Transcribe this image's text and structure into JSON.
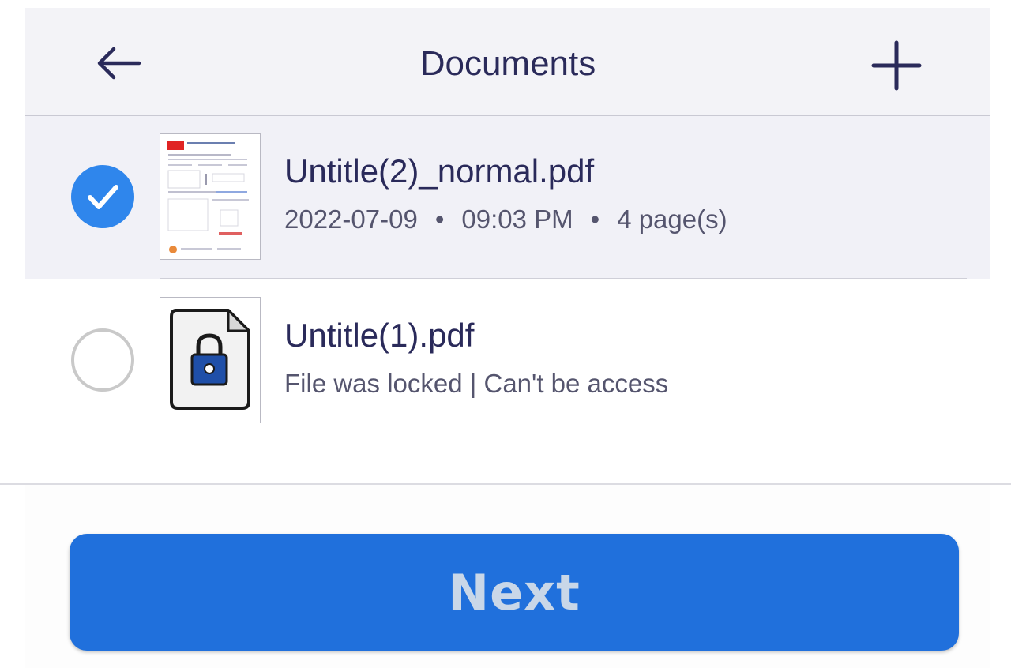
{
  "header": {
    "title": "Documents",
    "back_icon": "arrow-left-icon",
    "add_icon": "plus-icon"
  },
  "documents": [
    {
      "name": "Untitle(2)_normal.pdf",
      "selected": true,
      "date": "2022-07-09",
      "separator": "•",
      "time": "09:03 PM",
      "pages": "4 page(s)",
      "thumbnail": "pdf-page-thumbnail"
    },
    {
      "name": "Untitle(1).pdf",
      "selected": false,
      "status": "File was locked | Can't be access",
      "thumbnail": "locked-file-icon"
    }
  ],
  "footer": {
    "next_label": "Next"
  },
  "colors": {
    "accent": "#2f86ec",
    "button": "#2070dc",
    "text": "#2a2a5a",
    "selected_row": "#f1f1f7",
    "header_bg": "#f3f3f7"
  }
}
